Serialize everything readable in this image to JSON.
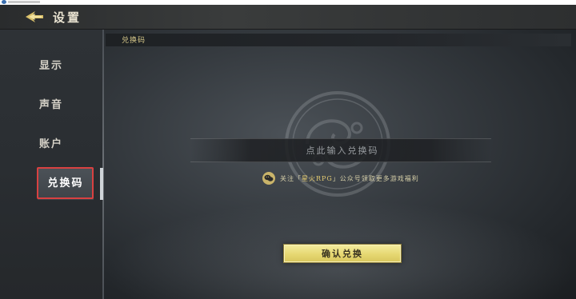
{
  "header": {
    "title": "设置",
    "back_icon": "back-arrow-icon"
  },
  "sidebar": {
    "items": [
      {
        "label": "显示",
        "active": false
      },
      {
        "label": "声音",
        "active": false
      },
      {
        "label": "账户",
        "active": false
      },
      {
        "label": "兑换码",
        "active": true
      }
    ]
  },
  "redeem": {
    "section_title": "兑换码",
    "input_placeholder": "点此输入兑换码",
    "input_value": "",
    "notice": {
      "icon": "wechat-icon",
      "prefix": "关注「",
      "account": "星火RPG",
      "suffix": "」公众号领取更多游戏福利"
    },
    "confirm_label": "确认兑换"
  },
  "colors": {
    "accent_gold": "#e6d872",
    "active_outline": "#d94141",
    "notice_text": "#d6cfa8"
  }
}
